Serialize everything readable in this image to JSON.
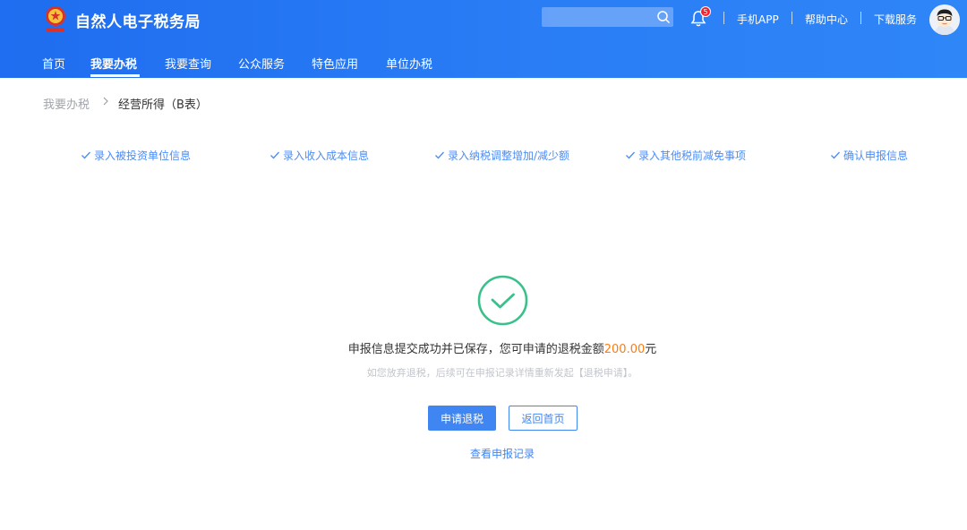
{
  "header": {
    "site_title": "自然人电子税务局",
    "search_placeholder": "",
    "notification_count": "5",
    "links": [
      "手机APP",
      "帮助中心",
      "下载服务"
    ]
  },
  "nav": {
    "items": [
      "首页",
      "我要办税",
      "我要查询",
      "公众服务",
      "特色应用",
      "单位办税"
    ],
    "active": "我要办税"
  },
  "breadcrumb": [
    "我要办税",
    "经营所得（B表）"
  ],
  "steps": [
    "录入被投资单位信息",
    "录入收入成本信息",
    "录入纳税调整增加/减少额",
    "录入其他税前减免事项",
    "确认申报信息"
  ],
  "result": {
    "message_prefix": "申报信息提交成功并已保存，您可申请的退税金额",
    "amount": "200.00",
    "message_suffix": "元",
    "hint": "如您放弃退税，后续可在申报记录详情重新发起【退税申请】。",
    "apply_button": "申请退税",
    "home_button": "返回首页",
    "view_records_link": "查看申报记录"
  },
  "colors": {
    "header_blue": "#2a7df5",
    "accent": "#3f86f3",
    "success_green": "#3cc08b",
    "amount_orange": "#fa7d14",
    "badge_red": "#f5222d"
  }
}
